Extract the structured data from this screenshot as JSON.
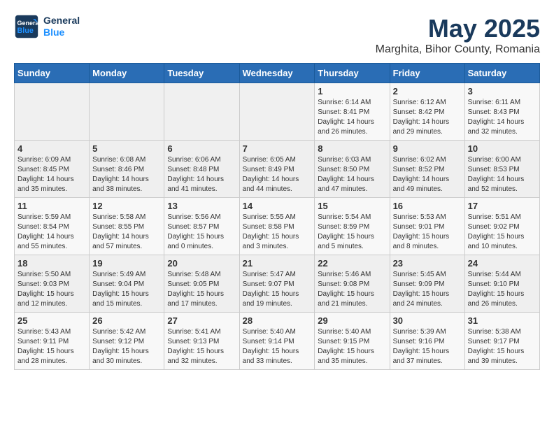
{
  "header": {
    "logo_line1": "General",
    "logo_line2": "Blue",
    "title": "May 2025",
    "subtitle": "Marghita, Bihor County, Romania"
  },
  "weekdays": [
    "Sunday",
    "Monday",
    "Tuesday",
    "Wednesday",
    "Thursday",
    "Friday",
    "Saturday"
  ],
  "weeks": [
    [
      {
        "day": "",
        "info": ""
      },
      {
        "day": "",
        "info": ""
      },
      {
        "day": "",
        "info": ""
      },
      {
        "day": "",
        "info": ""
      },
      {
        "day": "1",
        "info": "Sunrise: 6:14 AM\nSunset: 8:41 PM\nDaylight: 14 hours\nand 26 minutes."
      },
      {
        "day": "2",
        "info": "Sunrise: 6:12 AM\nSunset: 8:42 PM\nDaylight: 14 hours\nand 29 minutes."
      },
      {
        "day": "3",
        "info": "Sunrise: 6:11 AM\nSunset: 8:43 PM\nDaylight: 14 hours\nand 32 minutes."
      }
    ],
    [
      {
        "day": "4",
        "info": "Sunrise: 6:09 AM\nSunset: 8:45 PM\nDaylight: 14 hours\nand 35 minutes."
      },
      {
        "day": "5",
        "info": "Sunrise: 6:08 AM\nSunset: 8:46 PM\nDaylight: 14 hours\nand 38 minutes."
      },
      {
        "day": "6",
        "info": "Sunrise: 6:06 AM\nSunset: 8:48 PM\nDaylight: 14 hours\nand 41 minutes."
      },
      {
        "day": "7",
        "info": "Sunrise: 6:05 AM\nSunset: 8:49 PM\nDaylight: 14 hours\nand 44 minutes."
      },
      {
        "day": "8",
        "info": "Sunrise: 6:03 AM\nSunset: 8:50 PM\nDaylight: 14 hours\nand 47 minutes."
      },
      {
        "day": "9",
        "info": "Sunrise: 6:02 AM\nSunset: 8:52 PM\nDaylight: 14 hours\nand 49 minutes."
      },
      {
        "day": "10",
        "info": "Sunrise: 6:00 AM\nSunset: 8:53 PM\nDaylight: 14 hours\nand 52 minutes."
      }
    ],
    [
      {
        "day": "11",
        "info": "Sunrise: 5:59 AM\nSunset: 8:54 PM\nDaylight: 14 hours\nand 55 minutes."
      },
      {
        "day": "12",
        "info": "Sunrise: 5:58 AM\nSunset: 8:55 PM\nDaylight: 14 hours\nand 57 minutes."
      },
      {
        "day": "13",
        "info": "Sunrise: 5:56 AM\nSunset: 8:57 PM\nDaylight: 15 hours\nand 0 minutes."
      },
      {
        "day": "14",
        "info": "Sunrise: 5:55 AM\nSunset: 8:58 PM\nDaylight: 15 hours\nand 3 minutes."
      },
      {
        "day": "15",
        "info": "Sunrise: 5:54 AM\nSunset: 8:59 PM\nDaylight: 15 hours\nand 5 minutes."
      },
      {
        "day": "16",
        "info": "Sunrise: 5:53 AM\nSunset: 9:01 PM\nDaylight: 15 hours\nand 8 minutes."
      },
      {
        "day": "17",
        "info": "Sunrise: 5:51 AM\nSunset: 9:02 PM\nDaylight: 15 hours\nand 10 minutes."
      }
    ],
    [
      {
        "day": "18",
        "info": "Sunrise: 5:50 AM\nSunset: 9:03 PM\nDaylight: 15 hours\nand 12 minutes."
      },
      {
        "day": "19",
        "info": "Sunrise: 5:49 AM\nSunset: 9:04 PM\nDaylight: 15 hours\nand 15 minutes."
      },
      {
        "day": "20",
        "info": "Sunrise: 5:48 AM\nSunset: 9:05 PM\nDaylight: 15 hours\nand 17 minutes."
      },
      {
        "day": "21",
        "info": "Sunrise: 5:47 AM\nSunset: 9:07 PM\nDaylight: 15 hours\nand 19 minutes."
      },
      {
        "day": "22",
        "info": "Sunrise: 5:46 AM\nSunset: 9:08 PM\nDaylight: 15 hours\nand 21 minutes."
      },
      {
        "day": "23",
        "info": "Sunrise: 5:45 AM\nSunset: 9:09 PM\nDaylight: 15 hours\nand 24 minutes."
      },
      {
        "day": "24",
        "info": "Sunrise: 5:44 AM\nSunset: 9:10 PM\nDaylight: 15 hours\nand 26 minutes."
      }
    ],
    [
      {
        "day": "25",
        "info": "Sunrise: 5:43 AM\nSunset: 9:11 PM\nDaylight: 15 hours\nand 28 minutes."
      },
      {
        "day": "26",
        "info": "Sunrise: 5:42 AM\nSunset: 9:12 PM\nDaylight: 15 hours\nand 30 minutes."
      },
      {
        "day": "27",
        "info": "Sunrise: 5:41 AM\nSunset: 9:13 PM\nDaylight: 15 hours\nand 32 minutes."
      },
      {
        "day": "28",
        "info": "Sunrise: 5:40 AM\nSunset: 9:14 PM\nDaylight: 15 hours\nand 33 minutes."
      },
      {
        "day": "29",
        "info": "Sunrise: 5:40 AM\nSunset: 9:15 PM\nDaylight: 15 hours\nand 35 minutes."
      },
      {
        "day": "30",
        "info": "Sunrise: 5:39 AM\nSunset: 9:16 PM\nDaylight: 15 hours\nand 37 minutes."
      },
      {
        "day": "31",
        "info": "Sunrise: 5:38 AM\nSunset: 9:17 PM\nDaylight: 15 hours\nand 39 minutes."
      }
    ]
  ]
}
